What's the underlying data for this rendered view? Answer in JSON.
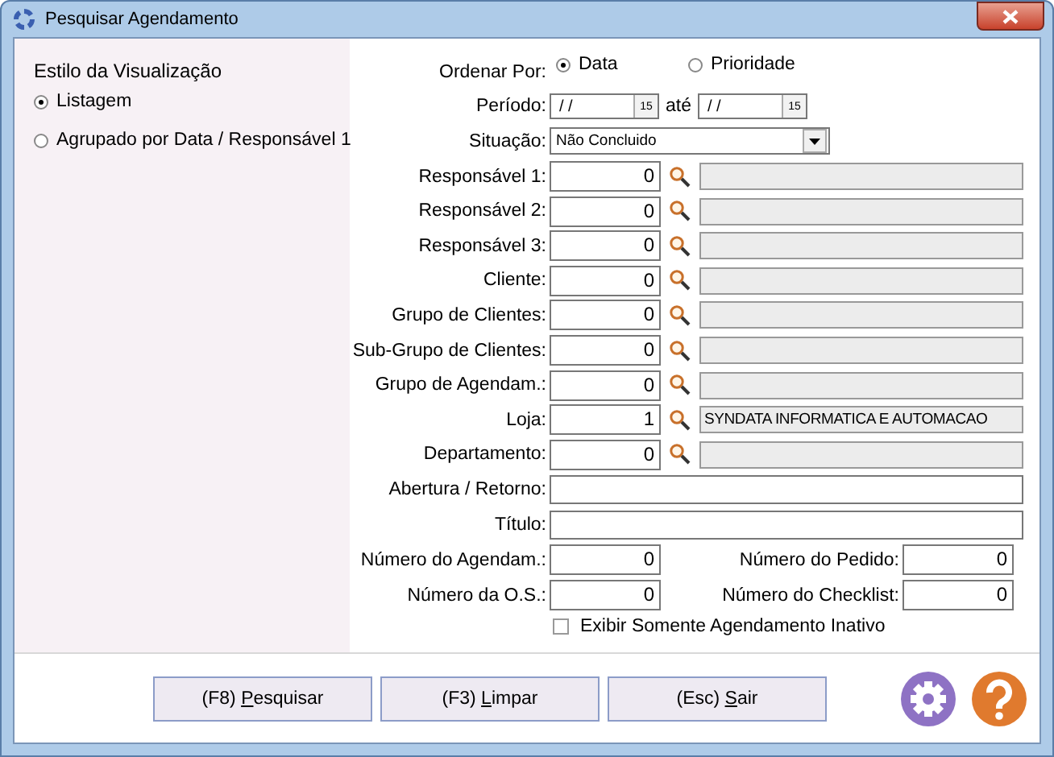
{
  "window": {
    "title": "Pesquisar Agendamento"
  },
  "view_style": {
    "title": "Estilo da Visualização",
    "options": [
      {
        "label": "Listagem",
        "selected": true
      },
      {
        "label": "Agrupado por Data / Responsável 1",
        "selected": false
      }
    ]
  },
  "order_by": {
    "label": "Ordenar Por:",
    "options": [
      {
        "label": "Data",
        "selected": true
      },
      {
        "label": "Prioridade",
        "selected": false
      }
    ]
  },
  "period": {
    "label": "Período:",
    "from": "/ /",
    "from_calendar": "15",
    "to_label": "até",
    "to": "/ /",
    "to_calendar": "15"
  },
  "status": {
    "label": "Situação:",
    "value": "Não Concluido"
  },
  "lookups": [
    {
      "label": "Responsável 1:",
      "code": "0"
    },
    {
      "label": "Responsável 2:",
      "code": "0"
    },
    {
      "label": "Responsável 3:",
      "code": "0"
    },
    {
      "label": "Cliente:",
      "code": "0"
    },
    {
      "label": "Grupo de Clientes:",
      "code": "0"
    },
    {
      "label": "Sub-Grupo de Clientes:",
      "code": "0"
    },
    {
      "label": "Grupo de Agendam.:",
      "code": "0"
    },
    {
      "label": "Loja:",
      "code": "1",
      "description": "SYNDATA INFORMATICA E AUTOMACAO"
    },
    {
      "label": "Departamento:",
      "code": "0"
    }
  ],
  "text_fields": [
    {
      "label": "Abertura / Retorno:"
    },
    {
      "label": "Título:"
    }
  ],
  "number_fields": [
    {
      "label": "Número do Agendam.:",
      "value": "0"
    },
    {
      "label": "Número do Pedido:",
      "value": "0"
    },
    {
      "label": "Número da O.S.:",
      "value": "0"
    },
    {
      "label": "Número do Checklist:",
      "value": "0"
    }
  ],
  "inactive_only": {
    "label": "Exibir Somente Agendamento Inativo",
    "checked": false
  },
  "buttons": [
    {
      "before": "(F8) ",
      "mnemonic": "P",
      "after": "esquisar"
    },
    {
      "before": "(F3) ",
      "mnemonic": "L",
      "after": "impar"
    },
    {
      "before": "(Esc) ",
      "mnemonic": "S",
      "after": "air"
    }
  ]
}
